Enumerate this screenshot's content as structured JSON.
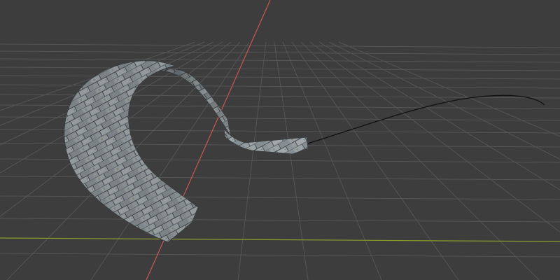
{
  "viewport": {
    "mode": "3D Viewport",
    "background_color": "#3d3d3d",
    "grid_color": "#555555",
    "x_axis_color": "#c9584c",
    "y_axis_color": "#8b9d2a"
  },
  "scene": {
    "objects": [
      {
        "name": "curved-stone-wall-mesh",
        "type": "mesh",
        "material": "stone-brick-texture",
        "base_color": "#8e979b"
      },
      {
        "name": "bezier-curve",
        "type": "curve",
        "color": "#111111"
      }
    ]
  }
}
